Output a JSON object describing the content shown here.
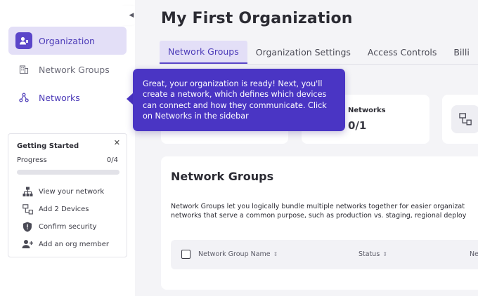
{
  "sidebar": {
    "items": [
      {
        "label": "Organization",
        "icon": "org-user-icon",
        "active": true
      },
      {
        "label": "Network Groups",
        "icon": "building-icon",
        "active": false
      },
      {
        "label": "Networks",
        "icon": "network-nodes-icon",
        "active": false
      }
    ],
    "getting_started": {
      "title": "Getting Started",
      "progress_label": "Progress",
      "progress_value": "0/4",
      "progress_fraction": 0,
      "items": [
        {
          "label": "View your network",
          "icon": "hierarchy-icon"
        },
        {
          "label": "Add 2 Devices",
          "icon": "devices-icon"
        },
        {
          "label": "Confirm security",
          "icon": "shield-icon"
        },
        {
          "label": "Add an org member",
          "icon": "add-person-icon"
        }
      ]
    }
  },
  "main": {
    "title": "My First Organization",
    "tabs": [
      {
        "label": "Network Groups",
        "active": true
      },
      {
        "label": "Organization Settings",
        "active": false
      },
      {
        "label": "Access Controls",
        "active": false
      },
      {
        "label": "Billi",
        "active": false
      }
    ],
    "stats": [
      {
        "label": "Networks",
        "value": "0/1"
      }
    ],
    "network_groups": {
      "title": "Network Groups",
      "description_line1": "Network Groups let you logically bundle multiple networks together for easier organizat",
      "description_line2": "networks that serve a common purpose, such as production vs. staging, regional deploy",
      "columns": [
        "Network Group Name",
        "Status",
        "Ne"
      ]
    }
  },
  "tooltip": {
    "text": "Great, your organization is ready! Next, you'll create a network, which defines which devices can connect and how they communicate. Click on Networks in the sidebar"
  },
  "colors": {
    "accent": "#5b46c9",
    "accent_light": "#e3dff7",
    "tooltip_bg": "#4a35c4",
    "background": "#f4f4f7"
  }
}
